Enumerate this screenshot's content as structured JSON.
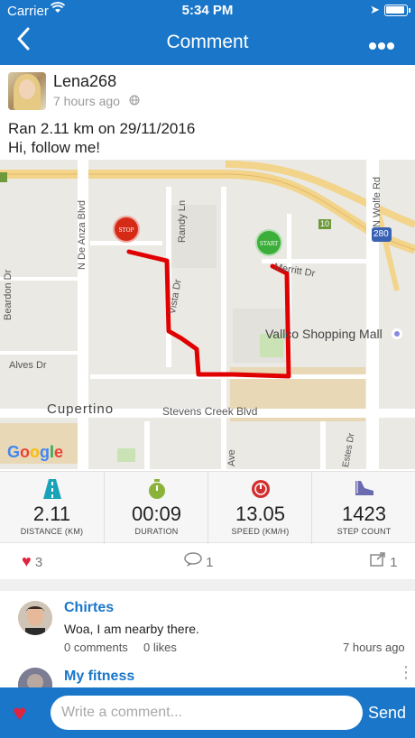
{
  "status_bar": {
    "carrier": "Carrier",
    "time": "5:34 PM"
  },
  "nav": {
    "title": "Comment",
    "back_icon": "chevron-left-icon",
    "more_icon": "more-dots-icon"
  },
  "post": {
    "username": "Lena268",
    "time_ago": "7 hours ago",
    "line1": "Ran 2.11 km on 29/11/2016",
    "line2": "Hi, follow me!"
  },
  "map": {
    "labels": {
      "de_anza": "N De Anza Blvd",
      "randy": "Randy Ln",
      "wolfe": "N Wolfe Rd",
      "beardon": "Beardon Dr",
      "alves": "Alves Dr",
      "cupertino": "Cupertino",
      "stevens": "Stevens Creek Blvd",
      "vallco": "Vallco Shopping Mall",
      "vista": "Vista Dr",
      "merritt": "Merritt Dr",
      "ave": "Ave",
      "stelling": "Portal Ave",
      "estes": "Estes Dr",
      "hwy280": "280",
      "hwy10a": "10",
      "hwy10b": "10"
    },
    "stop_label": "STOP",
    "start_label": "START",
    "google": [
      "G",
      "o",
      "o",
      "g",
      "l",
      "e"
    ],
    "route_color": "#e00000"
  },
  "stats": [
    {
      "value": "2.11",
      "label": "DISTANCE (KM)",
      "icon": "road-icon",
      "color": "#1aa3b8"
    },
    {
      "value": "00:09",
      "label": "DURATION",
      "icon": "stopwatch-icon",
      "color": "#8bb33a"
    },
    {
      "value": "13.05",
      "label": "SPEED (KM/H)",
      "icon": "speedometer-icon",
      "color": "#d32f2f"
    },
    {
      "value": "1423",
      "label": "STEP COUNT",
      "icon": "shoe-icon",
      "color": "#6a6ab0"
    }
  ],
  "actions": {
    "likes": "3",
    "comments": "1",
    "shares": "1"
  },
  "comments": [
    {
      "name": "Chirtes",
      "text": "Woa, I am nearby there.",
      "comments": "0 comments",
      "likes": "0 likes",
      "time": "7 hours ago"
    },
    {
      "name": "My fitness"
    }
  ],
  "compose": {
    "placeholder": "Write a comment...",
    "send": "Send"
  },
  "colors": {
    "brand": "#1976c9",
    "heart": "#e0233f"
  }
}
